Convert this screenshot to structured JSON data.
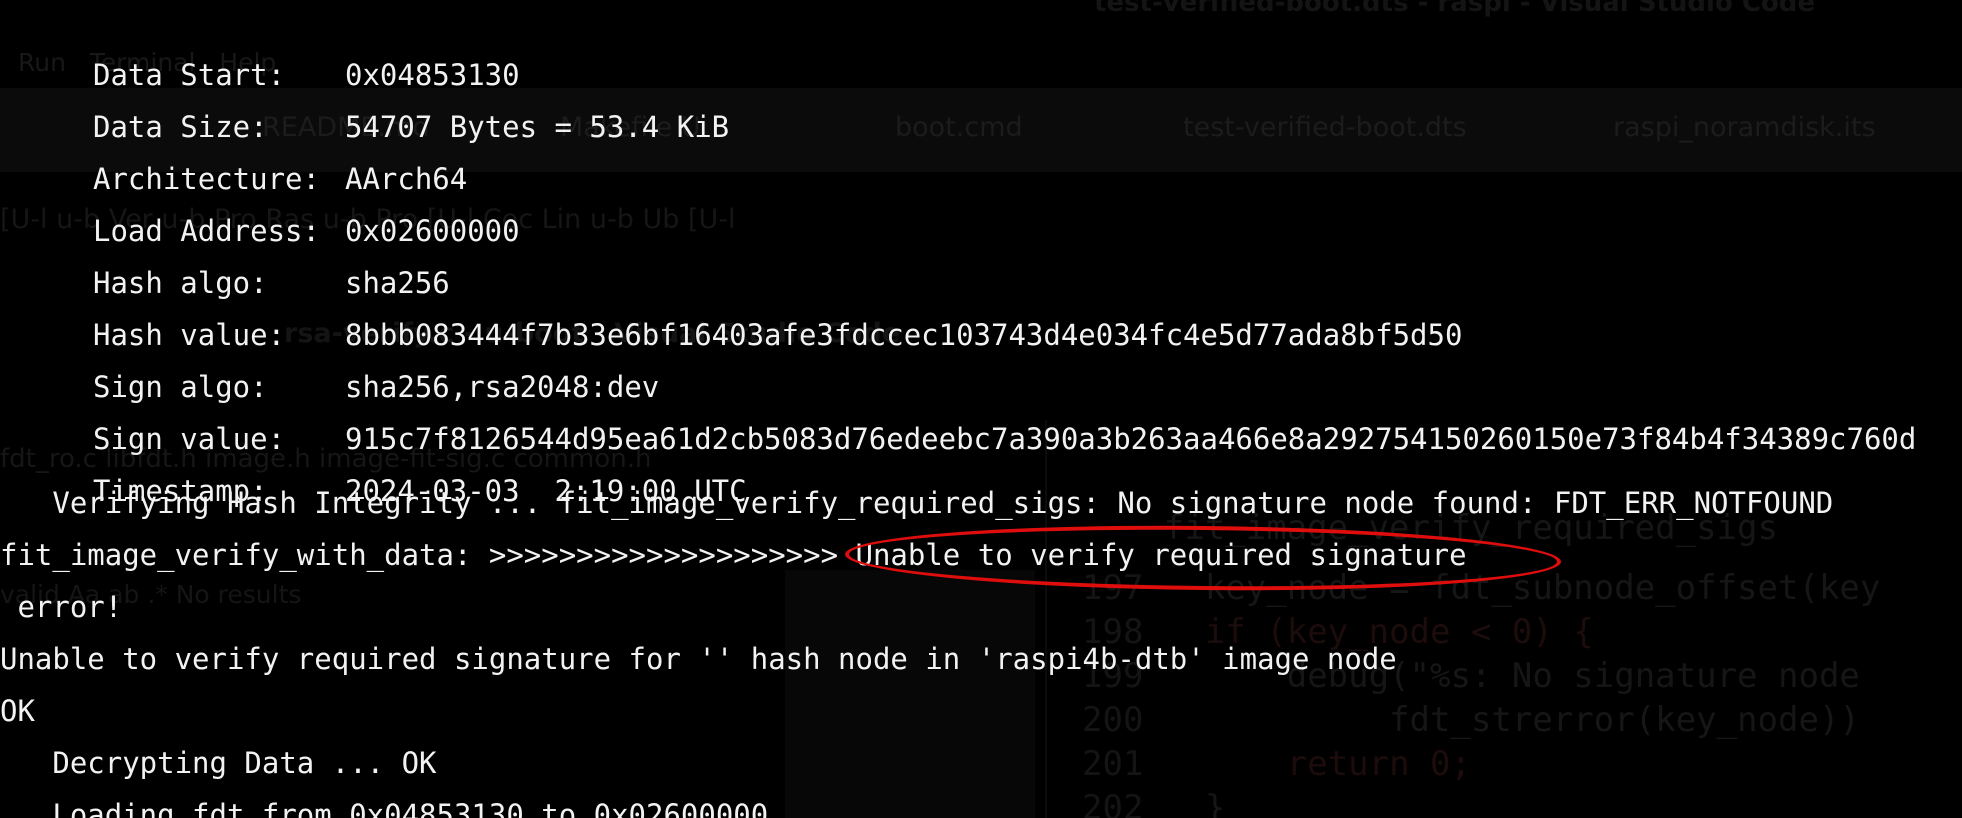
{
  "background_window": {
    "title": "test-verified-boot.dts - raspi - Visual Studio Code",
    "menu": [
      "Run",
      "Terminal",
      "Help"
    ],
    "tabs": [
      "README.md",
      "Makefile U",
      "boot.cmd",
      "test-verified-boot.dts",
      "raspi_noramdisk.its"
    ],
    "bookmarks": "[U-l   u-b   Ver   u-b   Pro   Ras   u-b   Pro   [U-l   Coc   Lin   u-b   Ub   [U-l",
    "secondary_title": "rsa-verify.c - u-boot - Visual Studio Code",
    "editor_tabs": "fdt_ro.c   libfdt.h   image.h   image-fit-sig.c   common.h",
    "find_widget": "valid   Aa  ab  .*   No results",
    "code_lines": [
      {
        "num": "",
        "text": "    fit_image_verify_required_sigs"
      },
      {
        "num": "197",
        "text": "  key_node = fdt_subnode_offset(key"
      },
      {
        "num": "198",
        "text": "  if (key_node < 0) {"
      },
      {
        "num": "199",
        "text": "      debug(\"%s: No signature node"
      },
      {
        "num": "200",
        "text": "           fdt_strerror(key_node))"
      },
      {
        "num": "201",
        "text": "      return 0;"
      },
      {
        "num": "202",
        "text": "  }"
      }
    ]
  },
  "terminal": {
    "fields": [
      {
        "key": "Data Start:",
        "value": "0x04853130"
      },
      {
        "key": "Data Size:",
        "value": "54707 Bytes = 53.4 KiB"
      },
      {
        "key": "Architecture:",
        "value": "AArch64"
      },
      {
        "key": "Load Address:",
        "value": "0x02600000"
      },
      {
        "key": "Hash algo:",
        "value": "sha256"
      },
      {
        "key": "Hash value:",
        "value": "8bbb083444f7b33e6bf16403afe3fdccec103743d4e034fc4e5d77ada8bf5d50"
      },
      {
        "key": "Sign algo:",
        "value": "sha256,rsa2048:dev"
      },
      {
        "key": "Sign value:",
        "value": "915c7f8126544d95ea61d2cb5083d76edeebc7a390a3b263aa466e8a292754150260150e73f84b4f34389c760d"
      },
      {
        "key": "Timestamp:",
        "value": "2024-03-03  2:19:00 UTC"
      }
    ],
    "lines": [
      "   Verifying Hash Integrity ... fit_image_verify_required_sigs: No signature node found: FDT_ERR_NOTFOUND",
      "fit_image_verify_with_data: >>>>>>>>>>>>>>>>>>>> Unable to verify required signature",
      " error!",
      "Unable to verify required signature for '' hash node in 'raspi4b-dtb' image node",
      "OK",
      "   Decrypting Data ... OK",
      "   Loading fdt from 0x04853130 to 0x02600000"
    ]
  },
  "annotation": {
    "shape": "ellipse",
    "color": "#e00d0d",
    "highlights": "Unable to verify required signature"
  }
}
